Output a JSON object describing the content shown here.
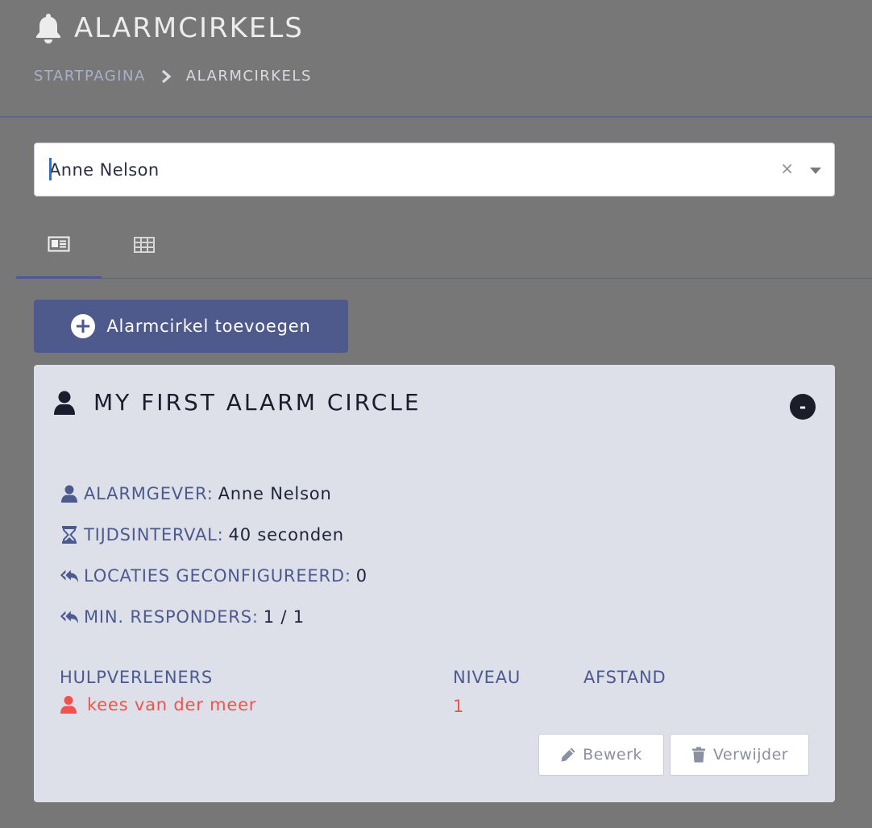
{
  "header": {
    "title": "ALARMCIRKELS",
    "title_icon": "bell-icon",
    "breadcrumb": {
      "home": "STARTPAGINA",
      "current": "ALARMCIRKELS"
    }
  },
  "person_select": {
    "value": "Anne Nelson",
    "clear_symbol": "×"
  },
  "tabs": [
    {
      "name": "card-view",
      "icon": "id-card-icon",
      "active": true
    },
    {
      "name": "table-view",
      "icon": "grid-table-icon",
      "active": false
    }
  ],
  "add_button": {
    "label": "Alarmcirkel toevoegen",
    "icon": "plus-circle-icon"
  },
  "circle": {
    "title": "MY FIRST ALARM CIRCLE",
    "collapse_symbol": "-",
    "alarm_giver_label": "ALARMGEVER:",
    "alarm_giver_value": "Anne Nelson",
    "interval_label": "TIJDSINTERVAL:",
    "interval_value": "40 seconden",
    "locations_label": "LOCATIES GECONFIGUREERD:",
    "locations_value": "0",
    "min_responders_label": "MIN. RESPONDERS:",
    "min_responders_value": "1 / 1",
    "columns": {
      "responders": "HULPVERLENERS",
      "level": "NIVEAU",
      "distance": "AFSTAND"
    },
    "responders": [
      {
        "name": "kees van der meer",
        "level": "1",
        "distance": ""
      }
    ],
    "edit_label": "Bewerk",
    "delete_label": "Verwijder"
  },
  "colors": {
    "background": "#777777",
    "accent": "#4e5a8c",
    "label": "#4c5a8e",
    "responder": "#f0534c",
    "card": "#dde0e9"
  }
}
